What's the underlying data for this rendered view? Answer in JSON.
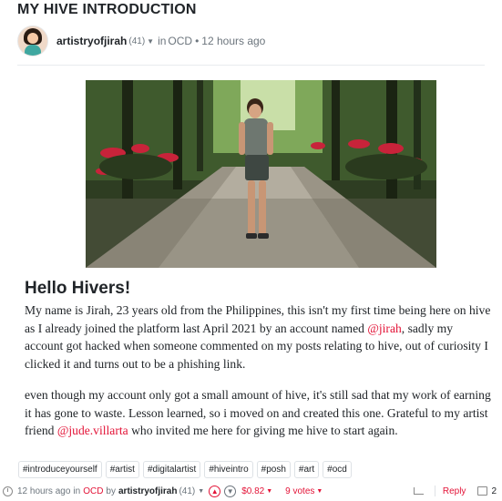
{
  "post": {
    "title": "MY HIVE INTRODUCTION",
    "author": "artistryofjirah",
    "reputation": "(41)",
    "in_label": "in",
    "category": "OCD",
    "time": "12 hours ago"
  },
  "content": {
    "heading": "Hello Hivers!",
    "p1_a": "My name is Jirah, 23 years old from the Philippines, this isn't my first time being here on hive as I already joined the platform last April 2021 by an account named ",
    "p1_mention": "@jirah",
    "p1_b": ", sadly my account got hacked when someone commented on my posts relating to hive, out of curiosity I clicked it and turns out to be a phishing link.",
    "p2_a": "even though my account only got a small amount of hive, it's still sad that my work of earning it has gone to waste. Lesson learned, so i moved on and created this one. Grateful to my artist friend ",
    "p2_mention": "@jude.villarta",
    "p2_b": " who invited me here for giving me hive to start again."
  },
  "tags": [
    "#introduceyourself",
    "#artist",
    "#digitalartist",
    "#hiveintro",
    "#posh",
    "#art",
    "#ocd"
  ],
  "footer": {
    "time": "12 hours ago",
    "in_label": "in",
    "category": "OCD",
    "by_label": "by",
    "author": "artistryofjirah",
    "reputation": "(41)",
    "payout": "$0.82",
    "votes": "9 votes",
    "reply": "Reply",
    "comments": "2"
  },
  "colors": {
    "accent": "#e31337",
    "text": "#212529",
    "muted": "#6c757d"
  },
  "icons": {
    "clock": "clock-icon",
    "upvote": "upvote-icon",
    "downvote": "downvote-icon",
    "reblog": "reblog-icon",
    "comments": "comments-icon",
    "caret": "caret-down-icon"
  }
}
